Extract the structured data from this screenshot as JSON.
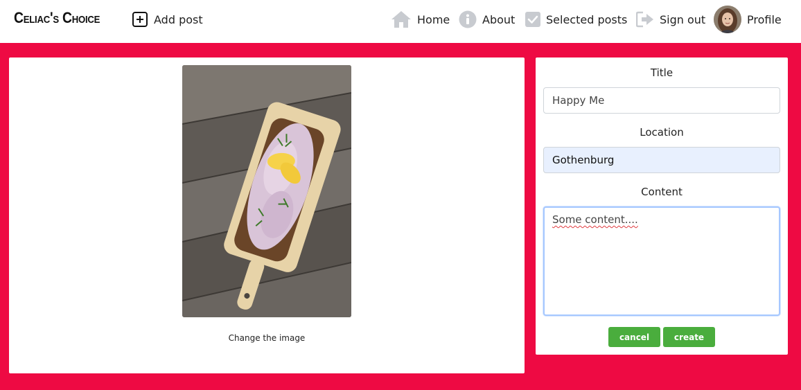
{
  "navbar": {
    "brand": "Celiac's Choice",
    "add_post": "Add post",
    "home": "Home",
    "about": "About",
    "selected_posts": "Selected posts",
    "sign_out": "Sign out",
    "profile": "Profile"
  },
  "image_panel": {
    "change_image": "Change the image"
  },
  "form": {
    "title_label": "Title",
    "title_value": "Happy Me",
    "location_label": "Location",
    "location_value": "Gothenburg",
    "content_label": "Content",
    "content_value": "Some content....",
    "cancel_label": "cancel",
    "create_label": "create"
  },
  "colors": {
    "accent_background": "#ee0a43",
    "button_green": "#4aad3d",
    "nav_icon_gray": "#c8cbd0",
    "autofill_blue": "#e8f0fe"
  },
  "icons": [
    "plus-square-icon",
    "home-icon",
    "info-icon",
    "check-square-icon",
    "sign-out-icon"
  ]
}
